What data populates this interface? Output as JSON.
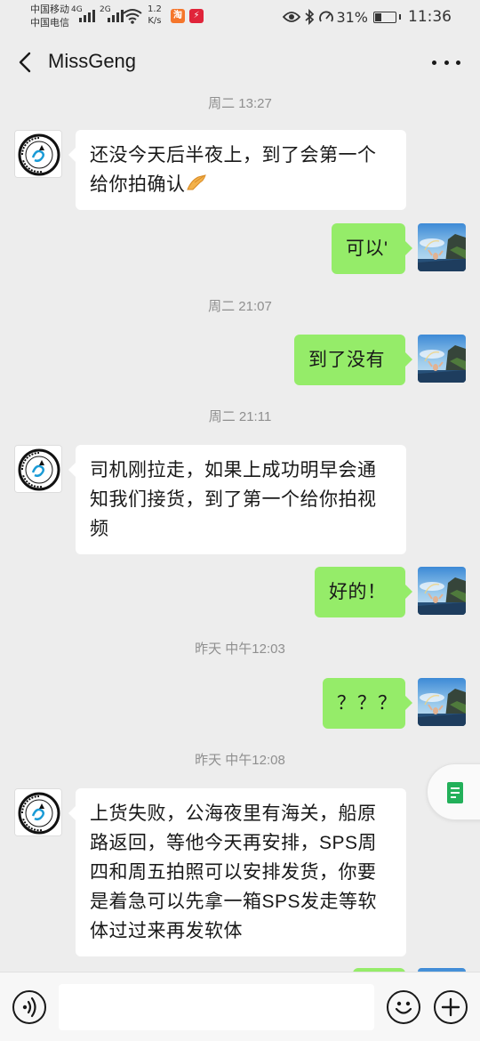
{
  "status_bar": {
    "carrier_1": "中国移动",
    "carrier_2": "中国电信",
    "network_1": "4G",
    "network_2": "2G",
    "speed_value": "1.2",
    "speed_unit": "K/s",
    "app_icon_1": "淘",
    "app_icon_2": "⚡",
    "battery_percent": "31%",
    "time": "11:36",
    "icons": [
      "signal-icon",
      "wifi-icon",
      "taobao-icon",
      "app-icon",
      "eye-icon",
      "bluetooth-icon",
      "speed-icon",
      "battery-icon"
    ]
  },
  "nav": {
    "back_icon": "chevron-left-icon",
    "title": "MissGeng",
    "more_icon": "more-dots-icon"
  },
  "contact": {
    "avatar_text": "WARUCTH MissGeng"
  },
  "messages": [
    {
      "type": "timestamp",
      "text": "周二 13:27"
    },
    {
      "type": "message",
      "side": "left",
      "text": "还没今天后半夜上，到了会第一个给你拍确认",
      "emoji": "pinched-fingers-emoji"
    },
    {
      "type": "message",
      "side": "right",
      "text": "可以'"
    },
    {
      "type": "timestamp",
      "text": "周二 21:07"
    },
    {
      "type": "message",
      "side": "right",
      "text": "到了没有"
    },
    {
      "type": "timestamp",
      "text": "周二 21:11"
    },
    {
      "type": "message",
      "side": "left",
      "text": "司机刚拉走，如果上成功明早会通知我们接货，到了第一个给你拍视频"
    },
    {
      "type": "message",
      "side": "right",
      "text": "好的！"
    },
    {
      "type": "timestamp",
      "text": "昨天 中午12:03"
    },
    {
      "type": "message",
      "side": "right",
      "text": "？？？"
    },
    {
      "type": "timestamp",
      "text": "昨天 中午12:08"
    },
    {
      "type": "message",
      "side": "left",
      "text": "上货失败，公海夜里有海关，船原路返回，等他今天再安排，SPS周四和周五拍照可以安排发货，你要是着急可以先拿一箱SPS发走等软体过过来再发软体"
    }
  ],
  "input_bar": {
    "voice_icon": "voice-icon",
    "placeholder": "",
    "emoji_icon": "emoji-icon",
    "plus_icon": "plus-icon"
  },
  "colors": {
    "background": "#ededed",
    "bubble_sent": "#95ec69",
    "bubble_received": "#ffffff",
    "timestamp": "#8f8f8f"
  }
}
